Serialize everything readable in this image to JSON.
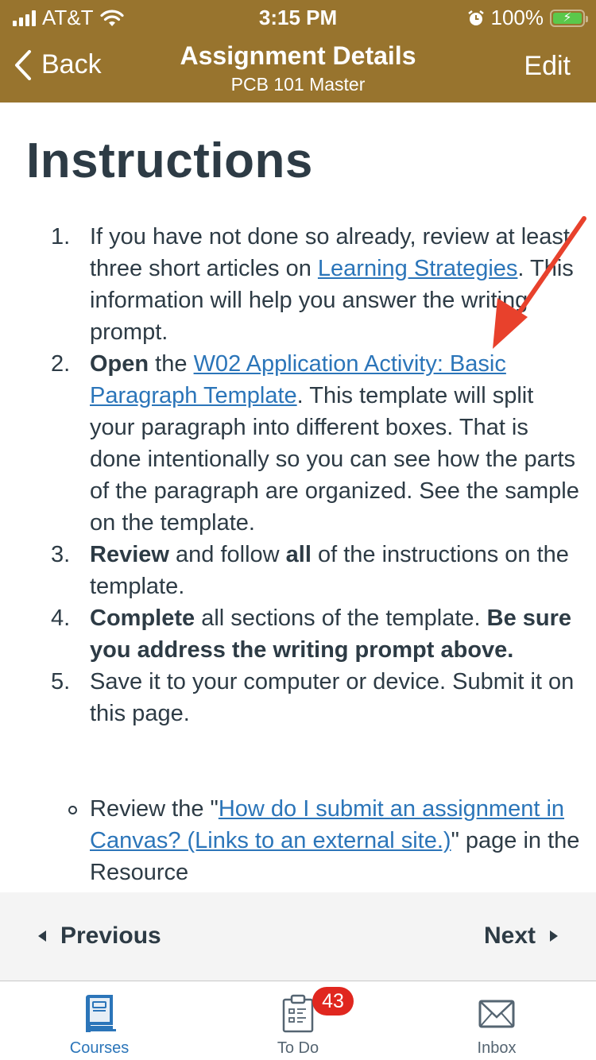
{
  "status_bar": {
    "carrier": "AT&T",
    "time": "3:15 PM",
    "battery_percent": "100%",
    "icons": [
      "signal-bars-icon",
      "wifi-icon",
      "alarm-icon",
      "battery-charging-icon"
    ]
  },
  "nav": {
    "back_label": "Back",
    "title": "Assignment Details",
    "subtitle": "PCB 101 Master",
    "edit_label": "Edit"
  },
  "colors": {
    "header_bg": "#98742e",
    "link": "#2b75b9",
    "text": "#2d3b45",
    "badge": "#e0271f",
    "annotation_arrow": "#e8412c"
  },
  "content": {
    "heading": "Instructions",
    "items": [
      {
        "number": "1.",
        "text_before": "If you have not done so already, review at least three short articles on ",
        "link": "Learning Strategies",
        "text_after": ". This information will help you answer the writing prompt."
      },
      {
        "number": "2.",
        "bold": "Open",
        "text_before": " the ",
        "link": "W02 Application Activity: Basic Paragraph Template",
        "text_after": ". This template will split your paragraph into different boxes. That is done intentionally so you can see how the parts of the paragraph are organized. See the sample on the template."
      },
      {
        "number": "3.",
        "bold": "Review",
        "text_mid": " and follow ",
        "bold2": "all",
        "text_after": " of the instructions on the template."
      },
      {
        "number": "4.",
        "bold": "Complete",
        "text_mid": " all sections of the template. ",
        "bold2": "Be sure you address the writing prompt above."
      },
      {
        "number": "5.",
        "text": "Save it to your computer or device. Submit it on this page.",
        "sub_items": [
          {
            "text_before": "Review the \"",
            "link": "How do I submit an assignment in Canvas? (Links to an external site.)",
            "text_after": "\" page in the Resource"
          }
        ]
      }
    ]
  },
  "pager": {
    "previous_label": "Previous",
    "next_label": "Next"
  },
  "tabs": [
    {
      "label": "Courses",
      "icon": "book-icon",
      "active": true
    },
    {
      "label": "To Do",
      "icon": "clipboard-icon",
      "badge": "43",
      "active": false
    },
    {
      "label": "Inbox",
      "icon": "envelope-icon",
      "active": false
    }
  ]
}
